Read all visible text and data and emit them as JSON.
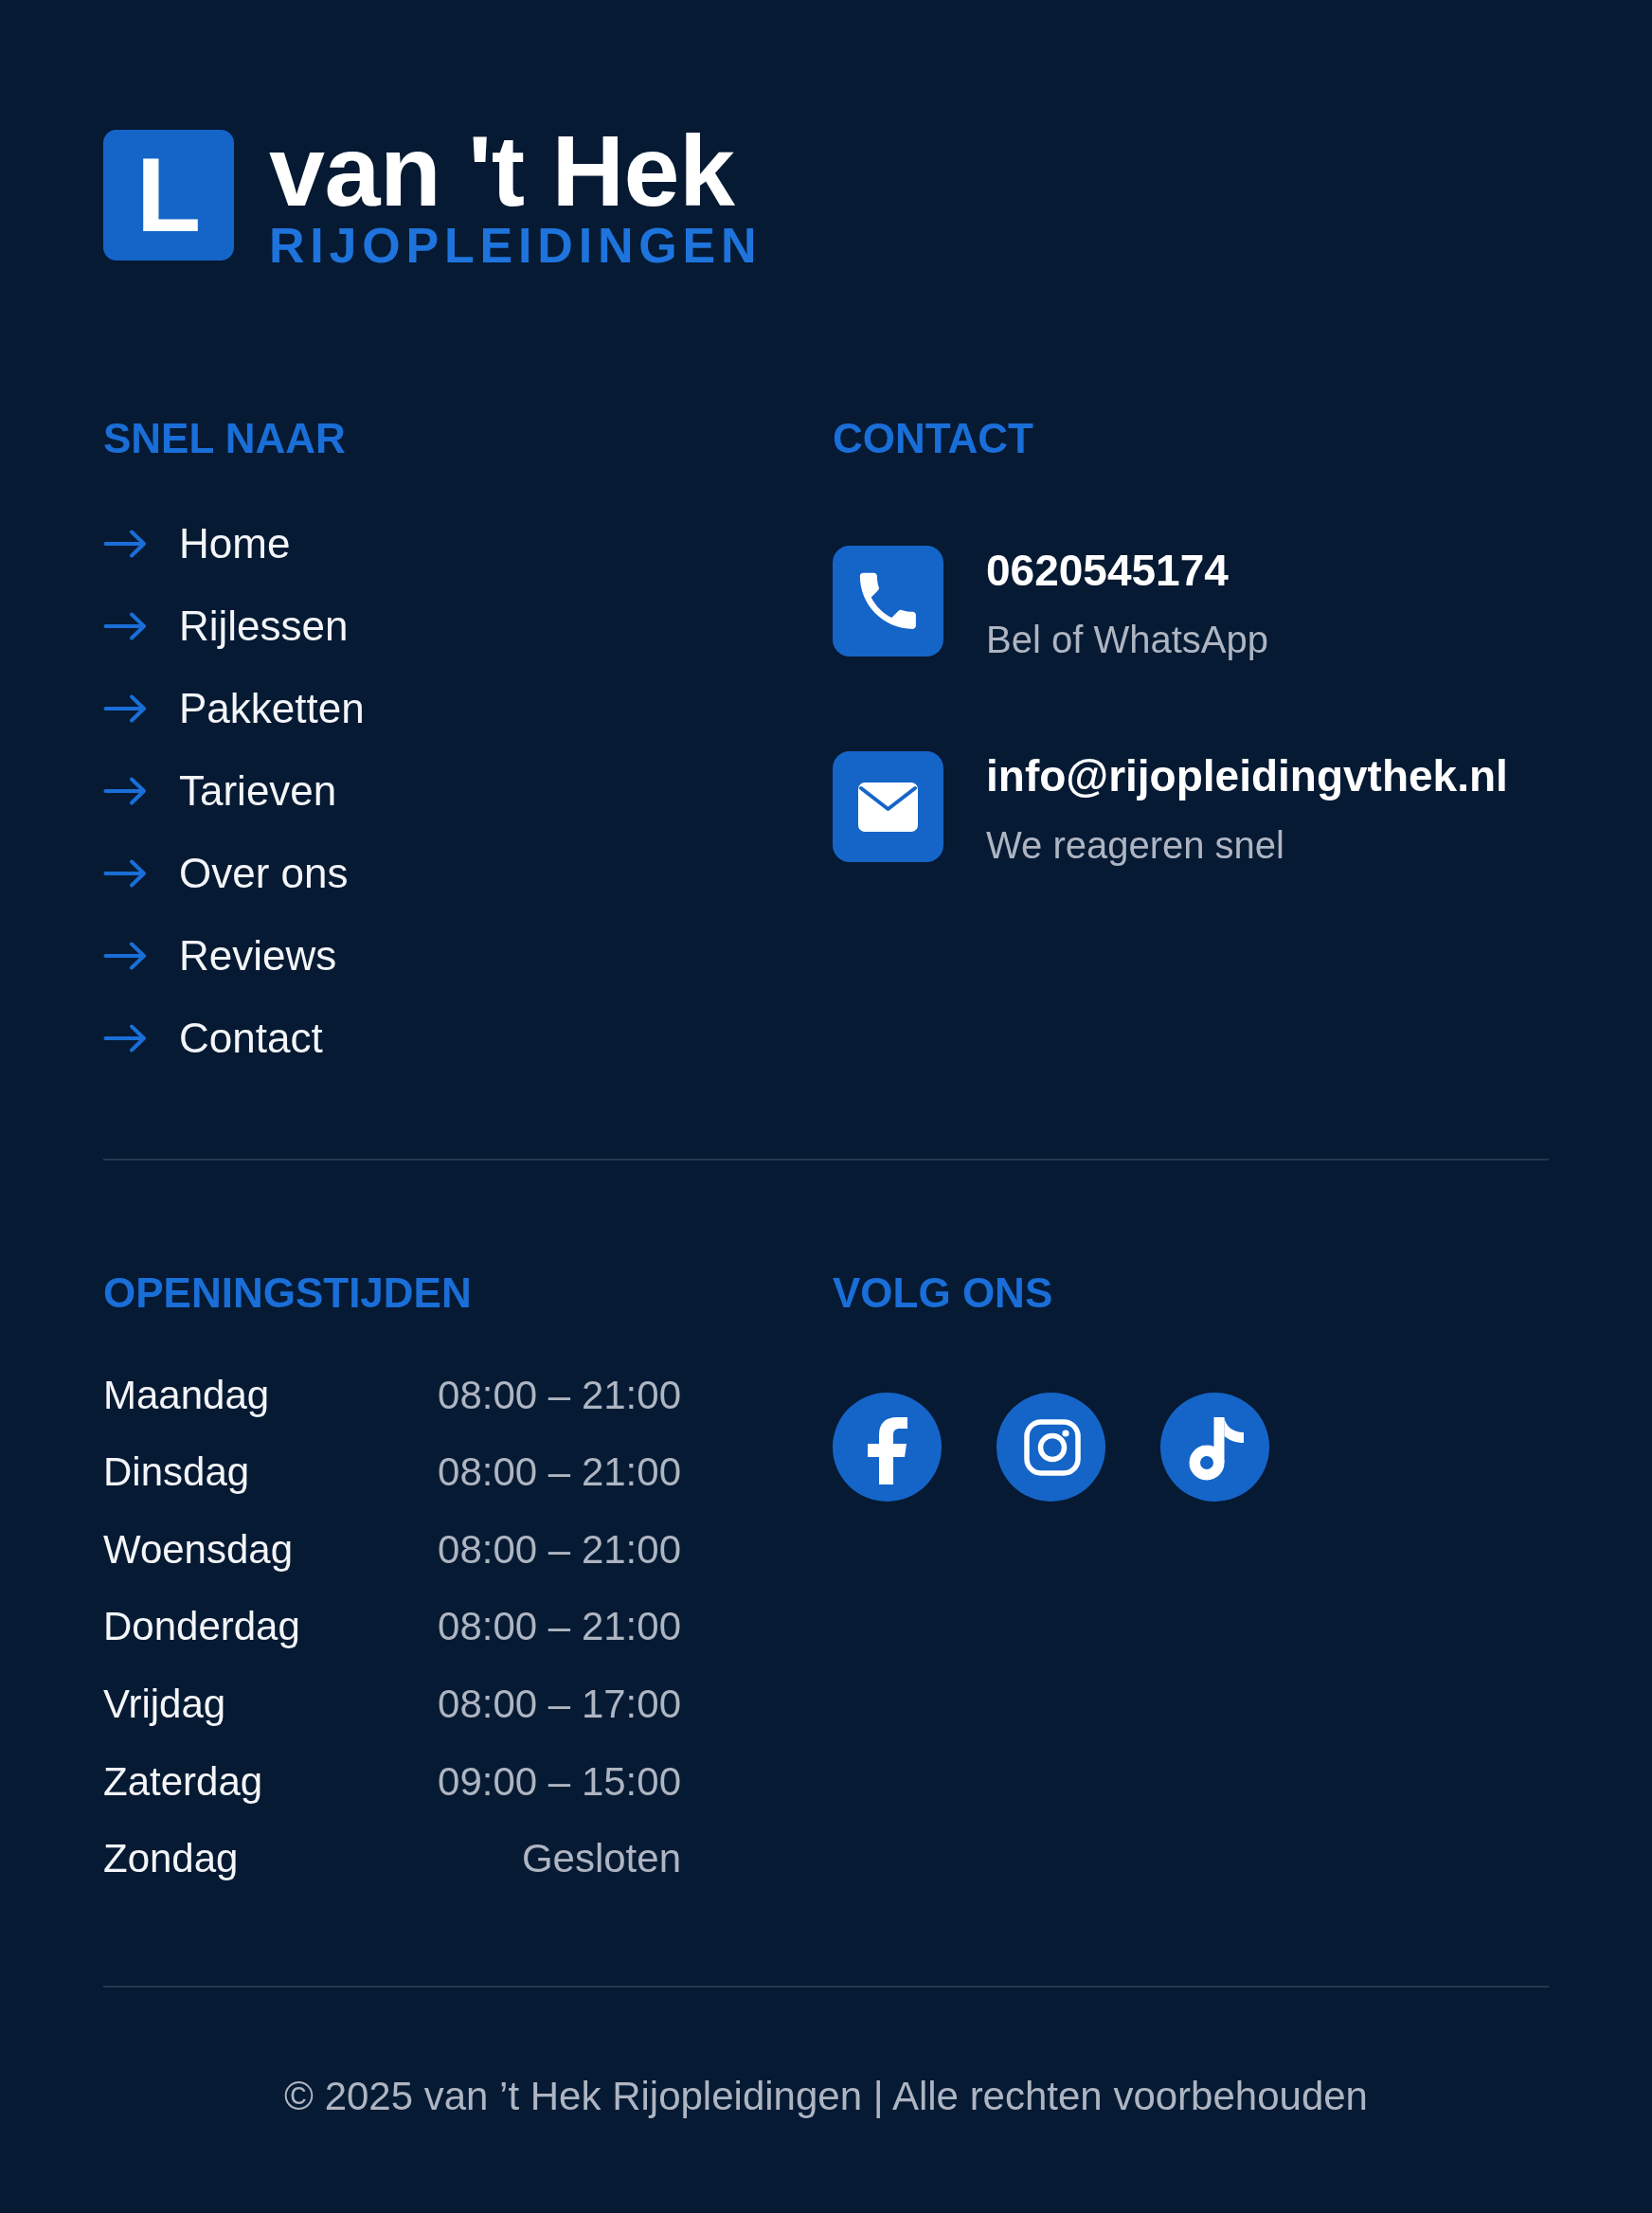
{
  "logo": {
    "badge": "L",
    "name": "van 't Hek",
    "tagline": "RIJOPLEIDINGEN"
  },
  "quick_links": {
    "title": "SNEL NAAR",
    "items": [
      "Home",
      "Rijlessen",
      "Pakketten",
      "Tarieven",
      "Over ons",
      "Reviews",
      "Contact"
    ]
  },
  "contact": {
    "title": "CONTACT",
    "items": [
      {
        "kind": "phone",
        "value": "0620545174",
        "note": "Bel of WhatsApp"
      },
      {
        "kind": "email",
        "value": "info@rijopleidingvthek.nl",
        "note": "We reageren snel"
      }
    ]
  },
  "opening_hours": {
    "title": "OPENINGSTIJDEN",
    "rows": [
      {
        "day": "Maandag",
        "hours": "08:00 – 21:00"
      },
      {
        "day": "Dinsdag",
        "hours": "08:00 – 21:00"
      },
      {
        "day": "Woensdag",
        "hours": "08:00 – 21:00"
      },
      {
        "day": "Donderdag",
        "hours": "08:00 – 21:00"
      },
      {
        "day": "Vrijdag",
        "hours": "08:00 – 17:00"
      },
      {
        "day": "Zaterdag",
        "hours": "09:00 – 15:00"
      },
      {
        "day": "Zondag",
        "hours": "Gesloten"
      }
    ]
  },
  "social": {
    "title": "VOLG ONS",
    "items": [
      {
        "kind": "facebook"
      },
      {
        "kind": "instagram"
      },
      {
        "kind": "tiktok"
      }
    ]
  },
  "footer": {
    "copyright": "© 2025 van ’t Hek Rijopleidingen | Alle rechten voorbehouden"
  }
}
